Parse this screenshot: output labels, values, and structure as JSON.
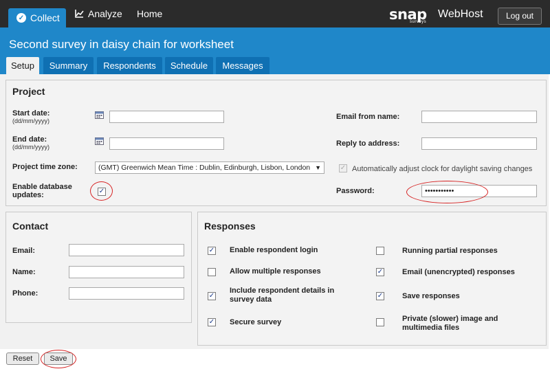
{
  "nav": {
    "collect": "Collect",
    "analyze": "Analyze",
    "home": "Home"
  },
  "brand": {
    "logo": "snap",
    "logo_sub": "surveys",
    "product": "WebHost",
    "logout": "Log out"
  },
  "page": {
    "title": "Second survey in daisy chain for worksheet"
  },
  "tabs": [
    "Setup",
    "Summary",
    "Respondents",
    "Schedule",
    "Messages"
  ],
  "project": {
    "heading": "Project",
    "start_date_label": "Start date:",
    "start_date_hint": "(dd/mm/yyyy)",
    "end_date_label": "End date:",
    "end_date_hint": "(dd/mm/yyyy)",
    "timezone_label": "Project time zone:",
    "timezone_value": "(GMT) Greenwich Mean Time : Dublin, Edinburgh, Lisbon, London",
    "db_updates_label": "Enable database updates:",
    "email_from_label": "Email from name:",
    "reply_to_label": "Reply to address:",
    "auto_adjust_label": "Automatically adjust clock for daylight saving changes",
    "password_label": "Password:",
    "password_value": "•••••••••••"
  },
  "contact": {
    "heading": "Contact",
    "email_label": "Email:",
    "name_label": "Name:",
    "phone_label": "Phone:"
  },
  "responses": {
    "heading": "Responses",
    "enable_login": "Enable respondent login",
    "allow_multiple": "Allow multiple responses",
    "include_details": "Include respondent details in survey data",
    "secure_survey": "Secure survey",
    "running_partial": "Running partial responses",
    "email_unencrypted": "Email (unencrypted) responses",
    "save_responses": "Save responses",
    "private_files": "Private (slower) image and multimedia files"
  },
  "buttons": {
    "reset": "Reset",
    "save": "Save"
  }
}
